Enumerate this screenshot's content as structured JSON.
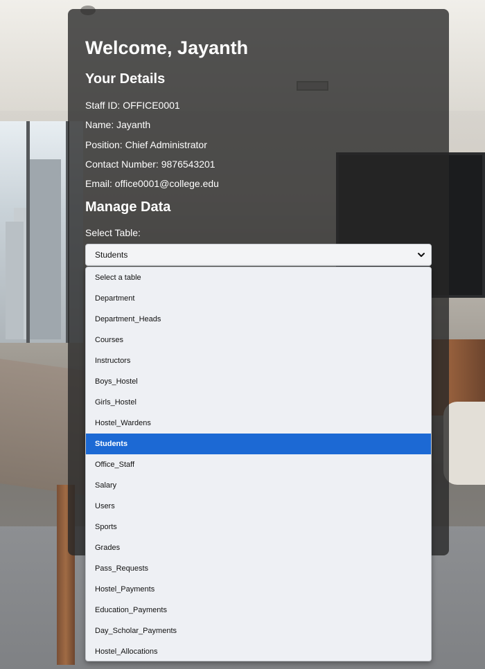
{
  "panel": {
    "welcome": "Welcome, Jayanth",
    "details_heading": "Your Details",
    "details": {
      "staff_id": "Staff ID: OFFICE0001",
      "name": "Name: Jayanth",
      "position": "Position: Chief Administrator",
      "contact": "Contact Number: 9876543201",
      "email": "Email: office0001@college.edu"
    },
    "manage_heading": "Manage Data",
    "select_label": "Select Table:",
    "selected_value": "Students"
  },
  "dropdown": {
    "options": [
      "Select a table",
      "Department",
      "Department_Heads",
      "Courses",
      "Instructors",
      "Boys_Hostel",
      "Girls_Hostel",
      "Hostel_Wardens",
      "Students",
      "Office_Staff",
      "Salary",
      "Users",
      "Sports",
      "Grades",
      "Pass_Requests",
      "Hostel_Payments",
      "Education_Payments",
      "Day_Scholar_Payments",
      "Hostel_Allocations"
    ],
    "selected_index": 8,
    "highlight_color": "#1c69d4"
  },
  "icons": {
    "select_arrow": "chevron-down-icon"
  }
}
